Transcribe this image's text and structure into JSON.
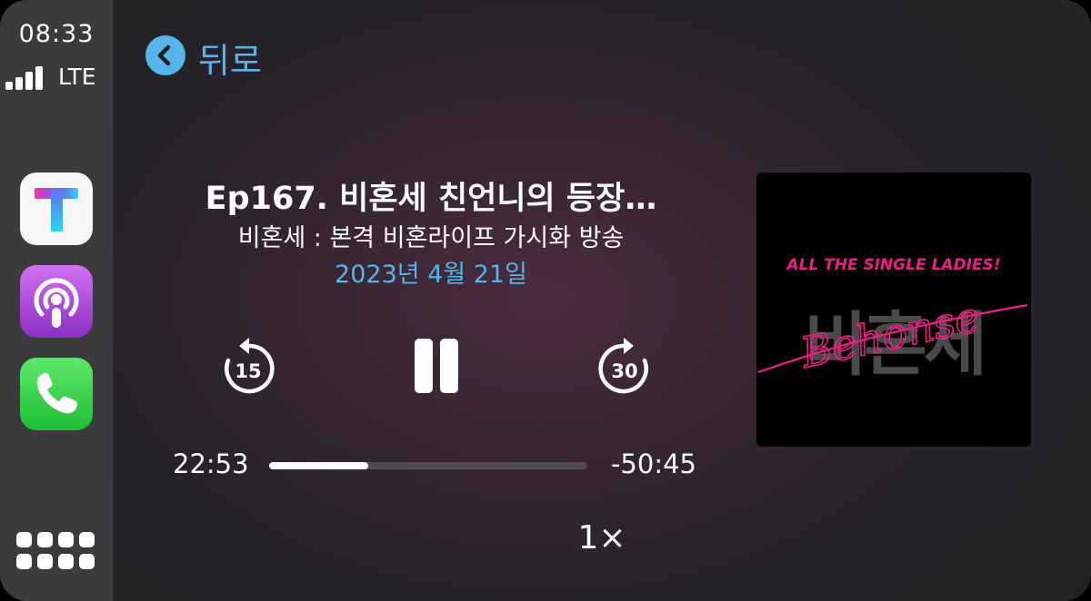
{
  "status_bar": {
    "time": "08:33",
    "network": "LTE",
    "signal_bars": 4
  },
  "sidebar": {
    "apps": [
      {
        "name": "TMAP",
        "icon": "tmap-icon"
      },
      {
        "name": "Podcasts",
        "icon": "podcasts-icon"
      },
      {
        "name": "Phone",
        "icon": "phone-icon"
      }
    ],
    "home_icon": "app-grid-icon"
  },
  "nav": {
    "back_label": "뒤로",
    "back_icon": "chevron-left-icon"
  },
  "episode": {
    "title": "Ep167. 비혼세 친언니의 등장…",
    "show": "비혼세 : 본격 비혼라이프 가시화 방송",
    "date": "2023년 4월 21일"
  },
  "controls": {
    "skip_back_label": "15",
    "skip_back_icon": "skip-back-15-icon",
    "pause_icon": "pause-icon",
    "skip_forward_label": "30",
    "skip_forward_icon": "skip-forward-30-icon",
    "speed_label": "1×"
  },
  "progress": {
    "elapsed": "22:53",
    "remaining": "-50:45",
    "fraction": 0.31
  },
  "artwork": {
    "tagline": "ALL THE SINGLE LADIES!",
    "logo_text": "비혼세",
    "script_text": "Behonse"
  },
  "colors": {
    "accent": "#54b4ec",
    "artwork_pink": "#ea1f84"
  }
}
